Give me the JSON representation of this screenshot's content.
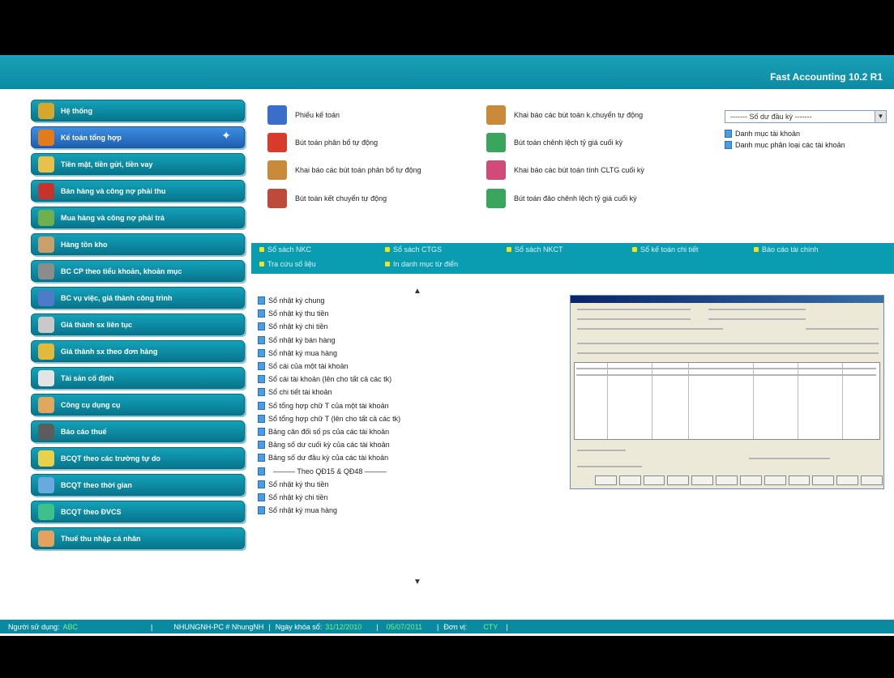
{
  "app": {
    "title": "Fast Accounting 10.2 R1"
  },
  "menu": [
    {
      "label": "Hệ thống",
      "color": "#d6a72c",
      "active": false
    },
    {
      "label": "Kế toán tổng hợp",
      "color": "#e27b1c",
      "active": true
    },
    {
      "label": "Tiền mặt, tiền gửi, tiền vay",
      "color": "#e8c14a",
      "active": false
    },
    {
      "label": "Bán hàng và công nợ phải thu",
      "color": "#c8322c",
      "active": false
    },
    {
      "label": "Mua hàng và công nợ phải trả",
      "color": "#6fb04c",
      "active": false
    },
    {
      "label": "Hàng tồn kho",
      "color": "#caa06a",
      "active": false
    },
    {
      "label": "BC CP theo tiểu khoản, khoản mục",
      "color": "#8c8c8c",
      "active": false
    },
    {
      "label": "BC vụ việc, giá thành công trình",
      "color": "#4d7bc9",
      "active": false
    },
    {
      "label": "Giá thành sx liên tục",
      "color": "#c9c9c9",
      "active": false
    },
    {
      "label": "Giá thành sx theo đơn hàng",
      "color": "#e2b93a",
      "active": false
    },
    {
      "label": "Tài sản cố định",
      "color": "#e4e4e4",
      "active": false
    },
    {
      "label": "Công cụ dụng cụ",
      "color": "#e0a85c",
      "active": false
    },
    {
      "label": "Báo cáo thuế",
      "color": "#5c5c5c",
      "active": false
    },
    {
      "label": "BCQT theo các trường tự do",
      "color": "#e8d24a",
      "active": false
    },
    {
      "label": "BCQT theo thời gian",
      "color": "#6aa9e0",
      "active": false
    },
    {
      "label": "BCQT theo ĐVCS",
      "color": "#3ec08a",
      "active": false
    },
    {
      "label": "Thuế thu nhập cá nhân",
      "color": "#e6a15c",
      "active": false
    }
  ],
  "functions": [
    {
      "label": "Phiếu kế toán",
      "color": "#3a6fc9"
    },
    {
      "label": "Bút toán phân bổ tự động",
      "color": "#d83b2c"
    },
    {
      "label": "Khai báo các bút toán phân bổ tự động",
      "color": "#c98a3a"
    },
    {
      "label": "Bút toán kết chuyển tự động",
      "color": "#c04a3a"
    },
    {
      "label": "Khai báo các bút toán k.chuyển tự động",
      "color": "#c98a3a"
    },
    {
      "label": "Bút toán chênh lệch tỷ giá cuối kỳ",
      "color": "#3aa55c"
    },
    {
      "label": "Khai báo các bút toán tính CLTG cuối kỳ",
      "color": "#d04a7a"
    },
    {
      "label": "Bút toán đảo chênh lệch tỷ giá cuối kỳ",
      "color": "#3aa55c"
    }
  ],
  "combo": {
    "value": "------- Số dư đầu kỳ -------"
  },
  "right_links": [
    "Danh mục tài khoản",
    "Danh mục phân loại các tài khoản"
  ],
  "tabs": [
    "Sổ sách NKC",
    "Sổ sách CTGS",
    "Sổ sách NKCT",
    "Sổ kế toán chi tiết",
    "Báo cáo tài chính",
    "Tra cứu số liệu",
    "In danh mục từ điển"
  ],
  "reports": [
    "Sổ nhật ký chung",
    "Sổ nhật ký thu tiền",
    "Sổ nhật ký chi tiền",
    "Sổ nhật ký bán hàng",
    "Sổ nhật ký mua hàng",
    "Sổ cái của một tài khoản",
    "Sổ cái tài khoản (lên cho tất cả các tk)",
    "Sổ chi tiết tài khoản",
    "Sổ tổng hợp chữ T của một tài khoản",
    "Sổ tổng hợp chữ T (lên cho tất cả các tk)",
    "Bảng cân đối số ps của các tài khoản",
    "Bảng số dư cuối kỳ của các tài khoản",
    "Bảng số dư đầu kỳ của các tài khoản",
    "——— Theo QĐ15 & QĐ48 ———",
    "Sổ nhật ký thu tiền",
    "Sổ nhật ký chi tiền",
    "Sổ nhật ký mua hàng"
  ],
  "status": {
    "user_label": "Người sử dụng:",
    "user": "ABC",
    "machine": "NHUNGNH-PC # NhungNH",
    "lock_label": "Ngày khóa sổ:",
    "lock_date": "31/12/2010",
    "date": "05/07/2011",
    "unit_label": "Đơn vị:",
    "unit": "CTY"
  }
}
